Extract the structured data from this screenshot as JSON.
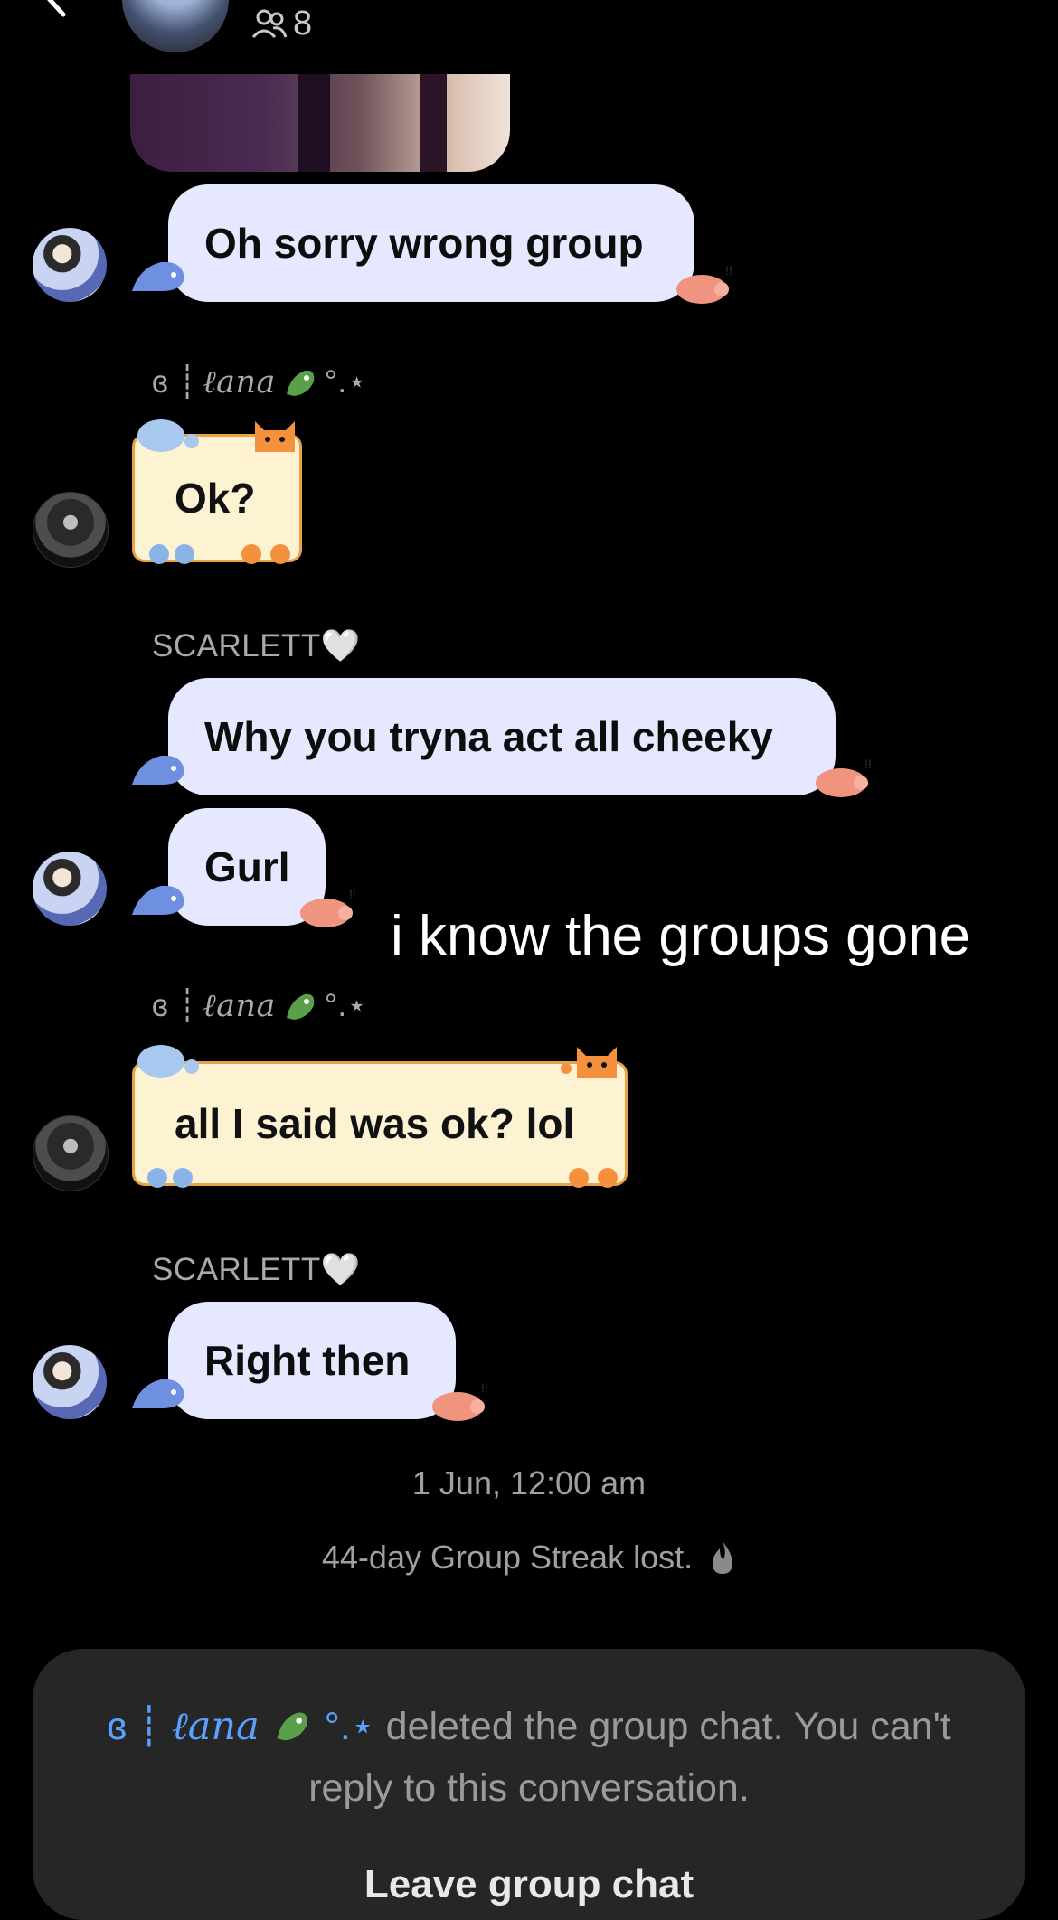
{
  "header": {
    "member_count": "8"
  },
  "messages": [
    {
      "text": "Oh sorry wrong group"
    },
    {
      "sender": "ℓana",
      "sender_prefix": "ɞ ┊",
      "sender_suffix": "°.⋆",
      "text": "Ok?"
    },
    {
      "sender": "SCARLETT🤍",
      "text": "Why you tryna act all cheeky"
    },
    {
      "text": "Gurl"
    },
    {
      "sender": "ℓana",
      "sender_prefix": "ɞ ┊",
      "sender_suffix": "°.⋆",
      "text": "all I said was ok? lol"
    },
    {
      "sender": "SCARLETT🤍",
      "text": "Right then"
    }
  ],
  "overlay_caption": "i know the groups gone",
  "timestamp": "1 Jun, 12:00 am",
  "streak_notice": "44-day Group Streak lost.",
  "footer": {
    "name_prefix": "ɞ ┊",
    "name": "ℓana",
    "name_suffix": "°.⋆",
    "message": "deleted the group chat. You can't reply to this conversation.",
    "action": "Leave group chat"
  },
  "colors": {
    "bubble": "#e6e8ff",
    "note": "#fdf3d2",
    "note_border": "#e8a24a",
    "link": "#5aa0ff"
  }
}
